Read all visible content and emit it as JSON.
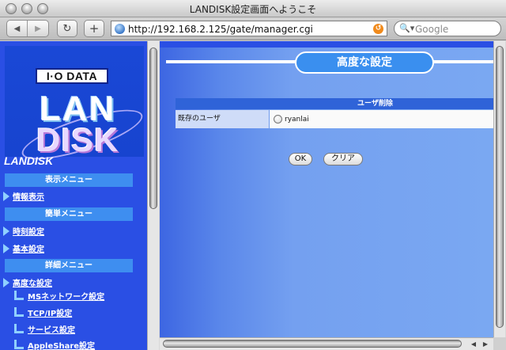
{
  "window": {
    "title": "LANDISK設定画面へようこそ"
  },
  "toolbar": {
    "back_icon": "back-arrow-icon",
    "forward_icon": "forward-arrow-icon",
    "reload_icon": "reload-icon",
    "add_icon": "plus-icon",
    "url": "http://192.168.2.125/gate/manager.cgi",
    "search_placeholder": "Google"
  },
  "sidebar": {
    "logo_brand": "I·O DATA",
    "logo_lan": "LAN",
    "logo_disk": "DISK",
    "site_name": "LANDISK",
    "sections": [
      {
        "heading": "表示メニュー",
        "items": [
          "情報表示"
        ]
      },
      {
        "heading": "簡単メニュー",
        "items": [
          "時刻設定",
          "基本設定"
        ]
      },
      {
        "heading": "詳細メニュー",
        "items": [
          "高度な設定"
        ],
        "subitems": [
          "MSネットワーク設定",
          "TCP/IP設定",
          "サービス設定",
          "AppleShare設定"
        ]
      }
    ]
  },
  "main": {
    "heading": "高度な設定",
    "section_title": "ユーザ削除",
    "rows": [
      {
        "label": "既存のユーザ",
        "option": "ryanlai"
      }
    ],
    "ok_label": "OK",
    "clear_label": "クリア"
  },
  "colors": {
    "sidebar_bg": "#2a4fe4",
    "menu_heading_bg": "#3e8ef0",
    "heading_pill_bg": "#3a8fef",
    "section_bar_bg": "#2f63d8"
  }
}
